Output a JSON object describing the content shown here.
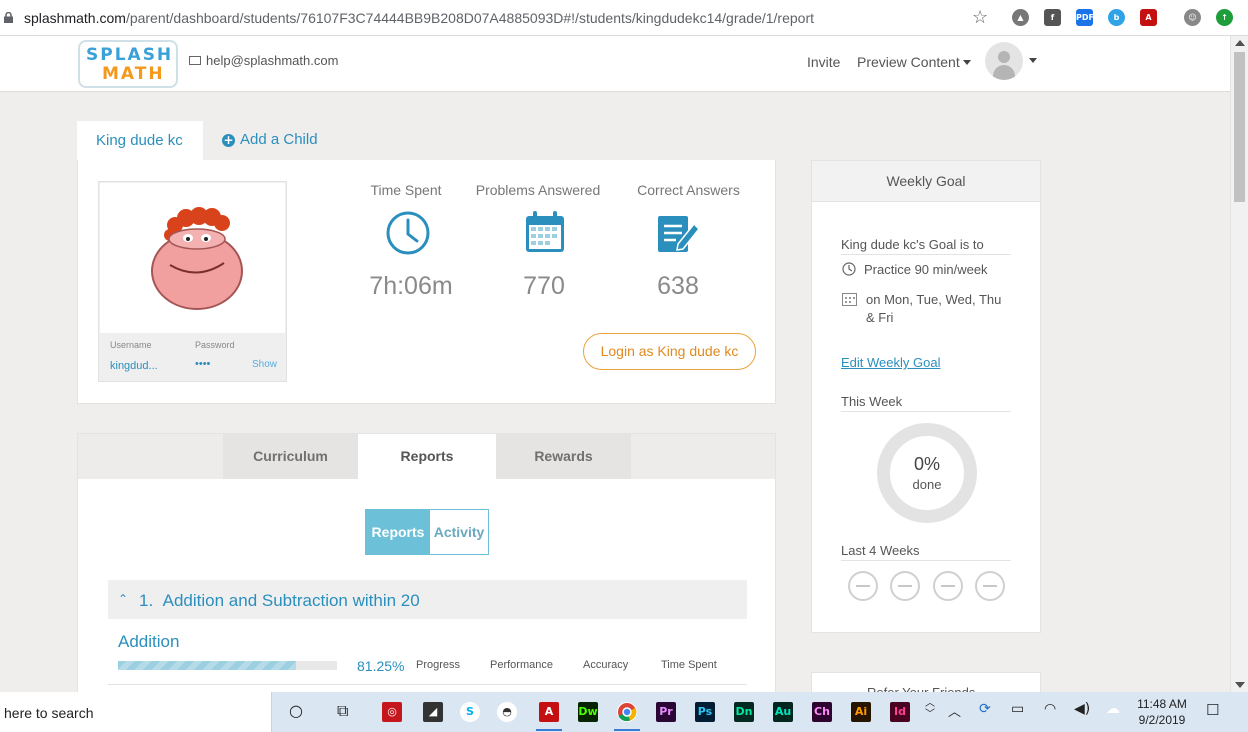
{
  "browser": {
    "url_main": "splashmath.com",
    "url_path": "/parent/dashboard/students/76107F3C74444BB9B208D07A4885093D#!/students/kingdudekc14/grade/1/report"
  },
  "header": {
    "logo_line1": "SPLASH",
    "logo_line2": "MATH",
    "help_email": "help@splashmath.com",
    "invite_label": "Invite",
    "preview_label": "Preview Content"
  },
  "child_tabs": {
    "active_child": "King dude kc",
    "add_child_label": "Add a Child"
  },
  "profile": {
    "username_label": "Username",
    "username_value": "kingdud...",
    "password_label": "Password",
    "password_value": "••••",
    "show_label": "Show",
    "stats": [
      {
        "label": "Time Spent",
        "value": "7h:06m",
        "icon": "clock-icon"
      },
      {
        "label": "Problems Answered",
        "value": "770",
        "icon": "calendar-icon"
      },
      {
        "label": "Correct Answers",
        "value": "638",
        "icon": "notepad-pencil-icon"
      }
    ],
    "login_button": "Login as King dude kc"
  },
  "weekly_goal": {
    "title": "Weekly Goal",
    "goal_intro": "King dude kc's Goal is to",
    "practice": "Practice 90 min/week",
    "days_line1": "on Mon, Tue, Wed, Thu",
    "days_line2": "& Fri",
    "edit_link": "Edit Weekly Goal",
    "this_week_label": "This Week",
    "done_pct": "0%",
    "done_label": "done",
    "last4_label": "Last 4 Weeks"
  },
  "refer": {
    "title": "Refer Your Friends"
  },
  "report_tabs": [
    "Curriculum",
    "Reports",
    "Rewards"
  ],
  "report_tab_active": "Reports",
  "toggle": {
    "reports": "Reports",
    "activity": "Activity"
  },
  "section": {
    "number": "1.",
    "title": "Addition and Subtraction within 20"
  },
  "skill": {
    "name": "Addition",
    "progress_pct": 81.25,
    "progress_text": "81.25%",
    "columns": [
      "Progress",
      "Performance",
      "Accuracy",
      "Time Spent"
    ]
  },
  "taskbar": {
    "search_text": "here to search",
    "time": "11:48 AM",
    "date": "9/2/2019",
    "apps": [
      "Dw",
      "Pr",
      "Ps",
      "Dn",
      "Au",
      "Ch",
      "Ai",
      "Id"
    ]
  },
  "colors": {
    "brand_blue": "#2a8fbd",
    "accent_orange": "#e8a33d",
    "toggle_teal": "#6cc1d8"
  }
}
